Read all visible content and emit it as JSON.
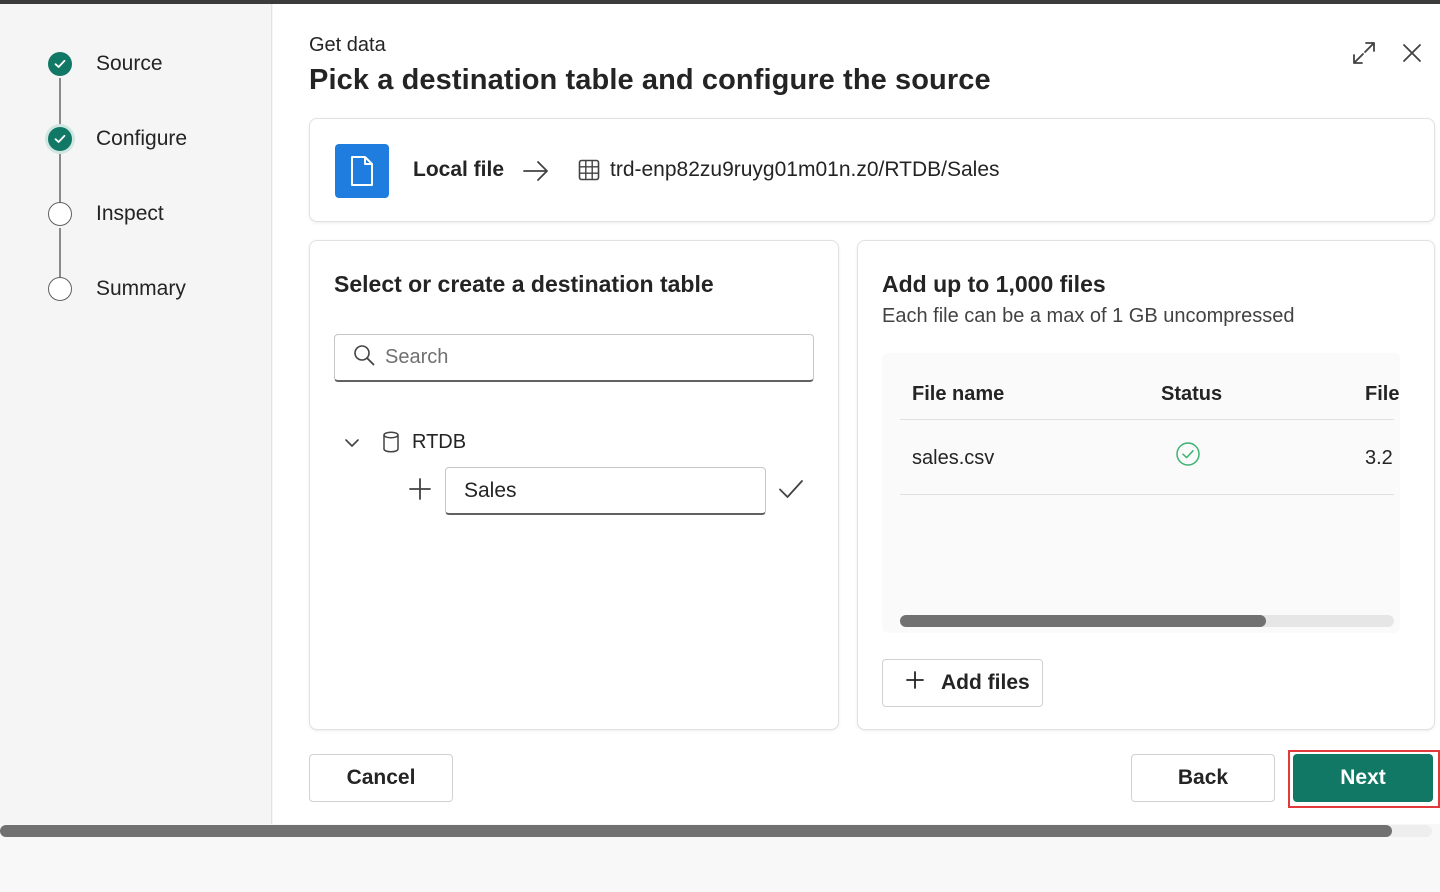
{
  "stepper": {
    "steps": [
      {
        "label": "Source",
        "state": "done"
      },
      {
        "label": "Configure",
        "state": "done"
      },
      {
        "label": "Inspect",
        "state": "todo"
      },
      {
        "label": "Summary",
        "state": "todo"
      }
    ]
  },
  "header": {
    "subtitle": "Get data",
    "title": "Pick a destination table and configure the source"
  },
  "source_bar": {
    "source_label": "Local file",
    "destination_path": "trd-enp82zu9ruyg01m01n.z0/RTDB/Sales"
  },
  "destination_panel": {
    "title": "Select or create a destination table",
    "search_placeholder": "Search",
    "database": "RTDB",
    "new_table_value": "Sales"
  },
  "files_panel": {
    "title": "Add up to 1,000 files",
    "subtitle": "Each file can be a max of 1 GB uncompressed",
    "columns": [
      "File name",
      "Status",
      "File s"
    ],
    "rows": [
      {
        "file_name": "sales.csv",
        "status": "success",
        "file_size": "3.2"
      }
    ],
    "add_files_label": "Add files"
  },
  "footer": {
    "cancel_label": "Cancel",
    "back_label": "Back",
    "next_label": "Next"
  },
  "colors": {
    "accent": "#117865",
    "file_tile": "#1f7ddf",
    "highlight": "#e03a3a",
    "success": "#3cb371"
  }
}
